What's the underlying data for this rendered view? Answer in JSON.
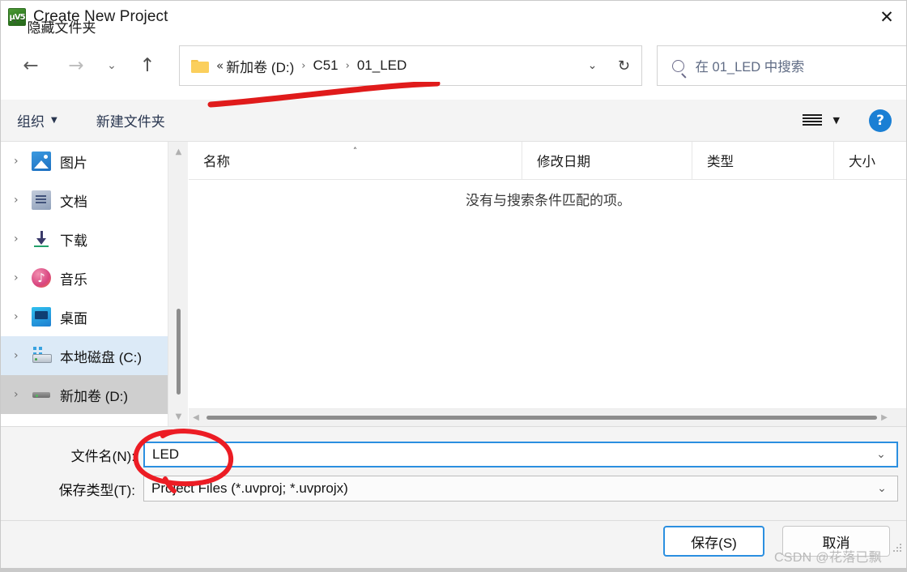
{
  "window": {
    "title": "Create New Project",
    "app_icon": "uvision-icon",
    "close_label": "✕"
  },
  "nav": {
    "back": "←",
    "forward": "→",
    "recent": "⌄",
    "up": "↑",
    "refresh": "↻",
    "address_chevron": "⌄"
  },
  "address": {
    "folder_icon": "folder-icon",
    "overflow": "«",
    "separator": "›",
    "crumbs": [
      "新加卷 (D:)",
      "C51",
      "01_LED"
    ]
  },
  "search": {
    "placeholder": "在 01_LED 中搜索",
    "value": ""
  },
  "commandbar": {
    "organize_label": "组织",
    "organize_caret": "▼",
    "new_folder_label": "新建文件夹",
    "view_caret": "▼",
    "help_label": "?"
  },
  "sidebar": {
    "chevron": "›",
    "items": [
      {
        "label": "图片",
        "icon": "pictures-icon",
        "state": "normal"
      },
      {
        "label": "文档",
        "icon": "documents-icon",
        "state": "normal"
      },
      {
        "label": "下载",
        "icon": "downloads-icon",
        "state": "normal"
      },
      {
        "label": "音乐",
        "icon": "music-icon",
        "state": "normal"
      },
      {
        "label": "桌面",
        "icon": "desktop-icon",
        "state": "normal"
      },
      {
        "label": "本地磁盘 (C:)",
        "icon": "drive-c-icon",
        "state": "highlighted"
      },
      {
        "label": "新加卷 (D:)",
        "icon": "drive-d-icon",
        "state": "selected"
      }
    ]
  },
  "filelist": {
    "columns": [
      {
        "label": "名称",
        "sorted": "asc",
        "sort_caret": "˄"
      },
      {
        "label": "修改日期",
        "sorted": "",
        "sort_caret": ""
      },
      {
        "label": "类型",
        "sorted": "",
        "sort_caret": ""
      },
      {
        "label": "大小",
        "sorted": "",
        "sort_caret": ""
      }
    ],
    "rows": [],
    "empty_message": "没有与搜索条件匹配的项。"
  },
  "scrollbars": {
    "up_arrow": "▲",
    "down_arrow": "▼",
    "left_arrow": "◀",
    "right_arrow": "▶"
  },
  "form": {
    "filename_label": "文件名(N):",
    "filename_value": "LED",
    "filetype_label": "保存类型(T):",
    "filetype_value": "Project Files (*.uvproj; *.uvprojx)",
    "chevron": "⌄"
  },
  "footer": {
    "hide_folders_label": "隐藏文件夹",
    "hide_folders_chevron": "˄",
    "save_label": "保存(S)",
    "cancel_label": "取消"
  },
  "watermark": {
    "text": "CSDN @花落已飘"
  },
  "annotations": {
    "underline_color": "#e01b1b",
    "circle_color": "#ec1c24"
  },
  "colors": {
    "accent": "#2b8fe0",
    "selection_blue": "#dceaf7",
    "selection_gray": "#cfcfcf",
    "chrome": "#f4f4f4",
    "help_blue": "#1a7fd4"
  }
}
